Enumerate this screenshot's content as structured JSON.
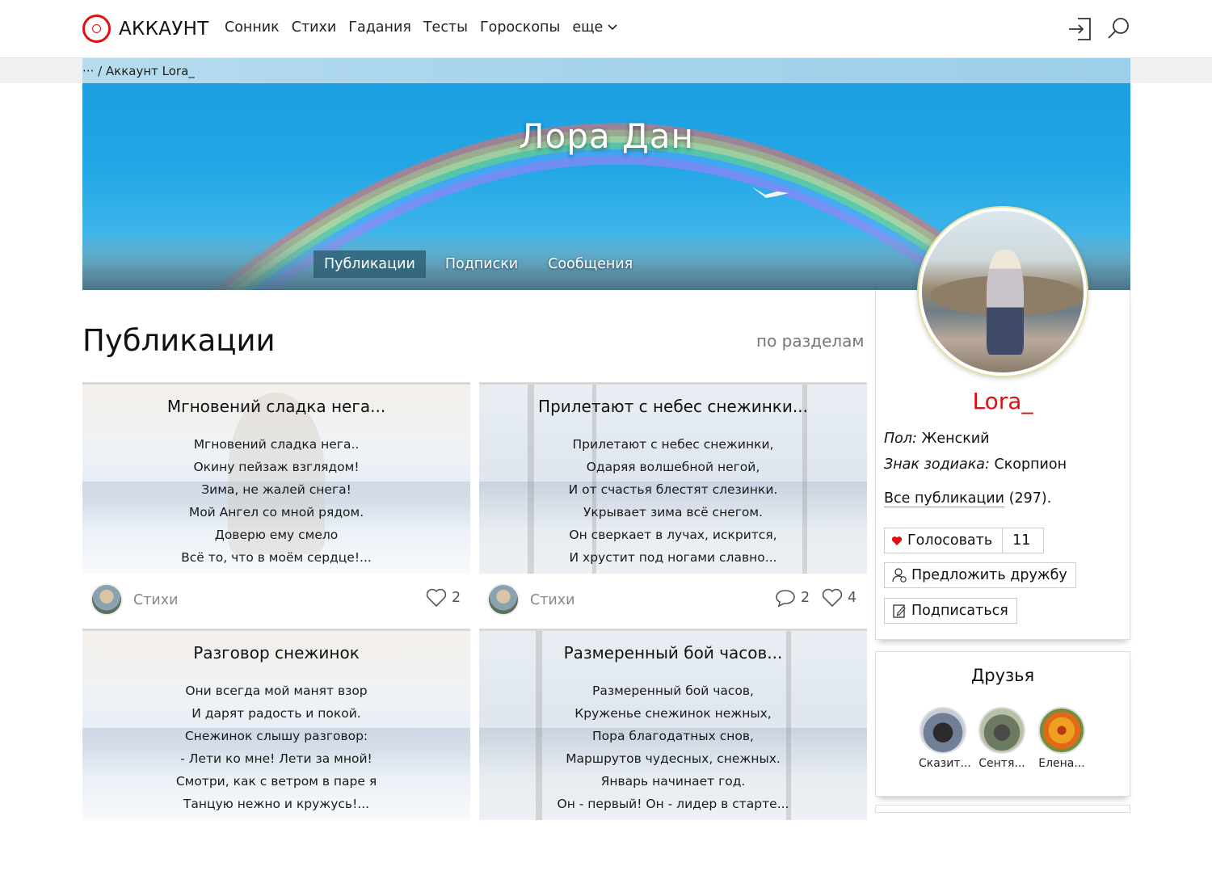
{
  "header": {
    "logo_text": "АККАУНТ",
    "brand_color": "#e01010",
    "nav": [
      "Сонник",
      "Стихи",
      "Гадания",
      "Тесты",
      "Гороскопы",
      "еще"
    ],
    "login_icon": "login-icon",
    "search_icon": "search-icon"
  },
  "breadcrumb": "··· / Аккаунт Lora_",
  "banner": {
    "title": "Лора  Дан",
    "tabs": [
      "Публикации",
      "Подписки",
      "Сообщения"
    ],
    "active_tab": "Публикации"
  },
  "publications": {
    "title": "Публикации",
    "sort_label": "по разделам",
    "cards": [
      {
        "title": "Мгновений сладка нега...",
        "lines": [
          "Мгновений сладка нега..",
          "Окину пейзаж взглядом!",
          "Зима, не жалей снега!",
          "Мой Ангел со мной рядом.",
          "Доверю ему смело",
          "Всё то, что в моём сердце!..."
        ],
        "category": "Стихи",
        "comments": null,
        "likes": "2"
      },
      {
        "title": "Прилетают с небес снежинки...",
        "lines": [
          "Прилетают с небес снежинки,",
          "Одаряя волшебной негой,",
          "И от счастья блестят слезинки.",
          "Укрывает зима всё снегом.",
          "Он сверкает в лучах, искрится,",
          "И хрустит под ногами славно..."
        ],
        "category": "Стихи",
        "comments": "2",
        "likes": "4"
      },
      {
        "title": "Разговор снежинок",
        "lines": [
          "Они всегда мой манят взор",
          "И дарят радость и покой.",
          "Снежинок слышу разговор:",
          "- Лети ко мне! Лети за мной!",
          "Смотри, как с ветром в паре я",
          "Танцую нежно и кружусь!..."
        ]
      },
      {
        "title": "Размеренный бой часов...",
        "lines": [
          "Размеренный бой часов,",
          "Круженье снежинок нежных,",
          "Пора благодатных снов,",
          "Маршрутов чудесных, снежных.",
          "Январь начинает год.",
          "Он - первый! Он - лидер в старте..."
        ]
      }
    ]
  },
  "profile": {
    "nick": "Lora_",
    "gender_label": "Пол:",
    "gender": "Женский",
    "zodiac_label": "Знак зодиака:",
    "zodiac": "Скорпион",
    "all_pubs_label": "Все публикации",
    "all_pubs_count": "(297).",
    "vote_label": "Голосовать",
    "vote_count": "11",
    "friend_label": "Предложить дружбу",
    "subscribe_label": "Подписаться"
  },
  "friends": {
    "title": "Друзья",
    "items": [
      "Сказит...",
      "Сентя...",
      "Елена..."
    ]
  }
}
